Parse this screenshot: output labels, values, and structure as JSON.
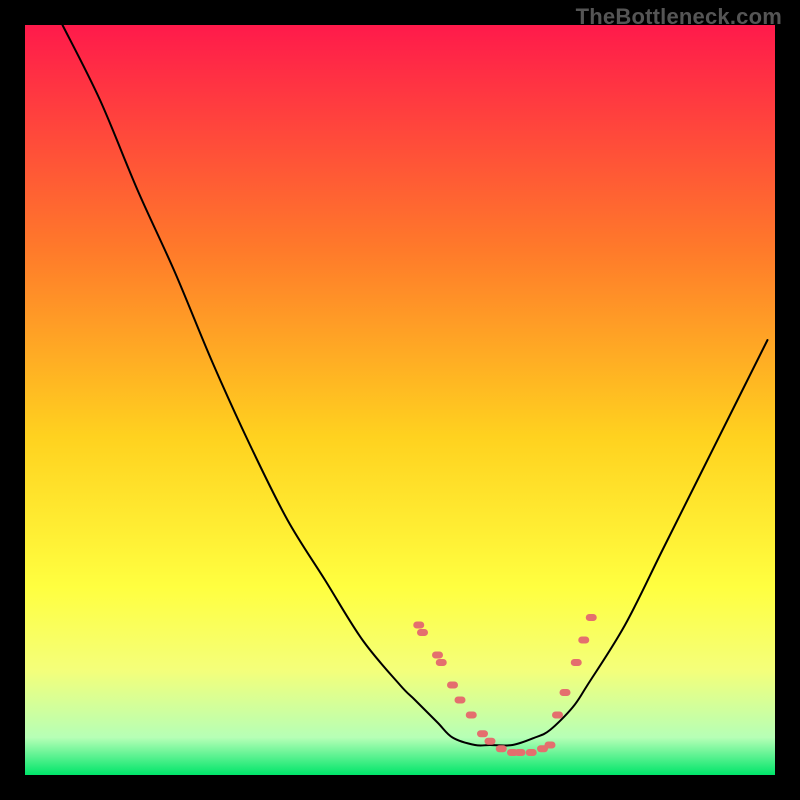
{
  "watermark": "TheBottleneck.com",
  "chart_data": {
    "type": "line",
    "title": "",
    "xlabel": "",
    "ylabel": "",
    "xlim": [
      0,
      100
    ],
    "ylim": [
      0,
      100
    ],
    "grid": false,
    "legend": false,
    "notes": "V-shaped bottleneck curve on rainbow (red→yellow→green) vertical gradient background bordered in black; pink dots mark samples near the valley.",
    "series": [
      {
        "name": "bottleneck-curve",
        "x": [
          5,
          10,
          15,
          20,
          25,
          30,
          35,
          40,
          45,
          50,
          52,
          55,
          57,
          60,
          62,
          65,
          68,
          70,
          73,
          75,
          80,
          85,
          90,
          95,
          99
        ],
        "values": [
          100,
          90,
          78,
          67,
          55,
          44,
          34,
          26,
          18,
          12,
          10,
          7,
          5,
          4,
          4,
          4,
          5,
          6,
          9,
          12,
          20,
          30,
          40,
          50,
          58
        ]
      }
    ],
    "highlight_points": {
      "name": "markers",
      "x": [
        52.5,
        53,
        55,
        55.5,
        57,
        58,
        59.5,
        61,
        62,
        63.5,
        65,
        66,
        67.5,
        69,
        70,
        71,
        72,
        73.5,
        74.5,
        75.5
      ],
      "values": [
        20,
        19,
        16,
        15,
        12,
        10,
        8,
        5.5,
        4.5,
        3.5,
        3,
        3,
        3,
        3.5,
        4,
        8,
        11,
        15,
        18,
        21
      ]
    },
    "background_gradient_stops": [
      {
        "offset": 0.0,
        "color": "#ff1a4b"
      },
      {
        "offset": 0.3,
        "color": "#ff7a2a"
      },
      {
        "offset": 0.55,
        "color": "#ffd21f"
      },
      {
        "offset": 0.75,
        "color": "#ffff40"
      },
      {
        "offset": 0.86,
        "color": "#f4ff7a"
      },
      {
        "offset": 0.95,
        "color": "#b6ffb6"
      },
      {
        "offset": 1.0,
        "color": "#00e56a"
      }
    ]
  }
}
